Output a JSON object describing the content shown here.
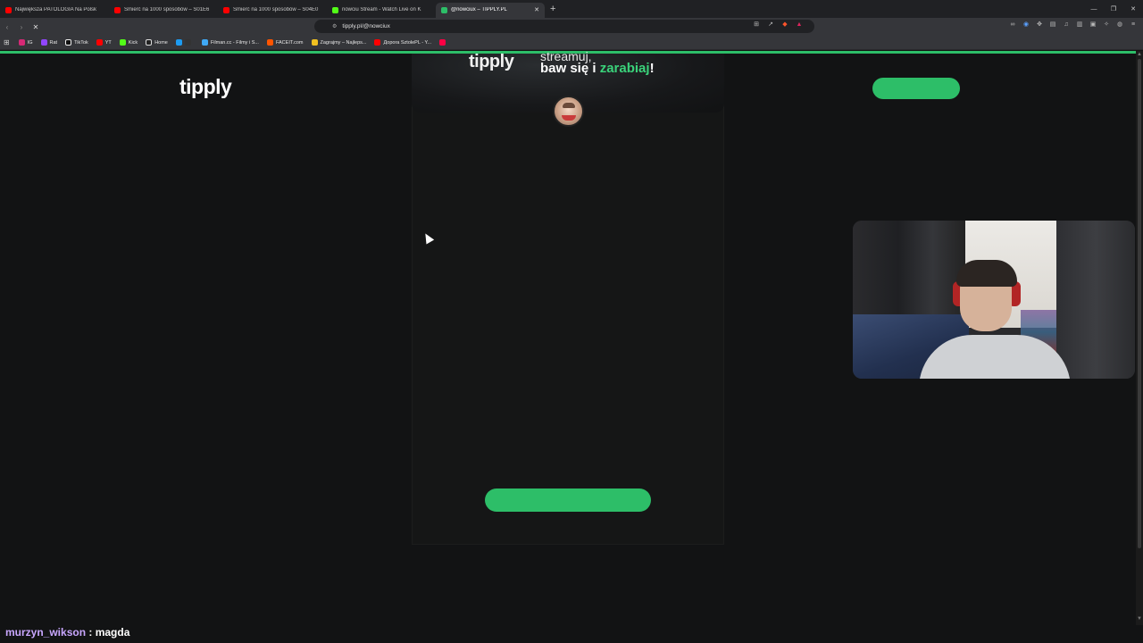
{
  "tabs": [
    {
      "title": "Największa PATOLOGIA Na Polsk",
      "favicon_color": "#ff0000",
      "active": false
    },
    {
      "title": "Śmierć na 1000 sposobów – S01E6",
      "favicon_color": "#ff0000",
      "active": false
    },
    {
      "title": "Śmierć na 1000 sposobów – S04E0",
      "favicon_color": "#ff0000",
      "active": false
    },
    {
      "title": "nowciu Stream - Watch Live on K",
      "favicon_color": "#53fc18",
      "active": false
    },
    {
      "title": "@nowciux – TIPPLY.PL",
      "favicon_color": "#2dbe68",
      "active": true
    }
  ],
  "address": {
    "url": "tipply.pl/@nowciux"
  },
  "bookmarks": [
    {
      "label": "IG",
      "color": "#d62976"
    },
    {
      "label": "Rat",
      "color": "#9146ff"
    },
    {
      "label": "TikTok",
      "color": "#eeeeee"
    },
    {
      "label": "YT",
      "color": "#ff0000"
    },
    {
      "label": "Kick",
      "color": "#53fc18"
    },
    {
      "label": "Home",
      "color": "#dddddd"
    },
    {
      "label": "",
      "color": "#1d9bf0"
    },
    {
      "label": "Filman.cc - Filmy i S...",
      "color": "#3fa9f5"
    },
    {
      "label": "FACEIT.com",
      "color": "#ff5500"
    },
    {
      "label": "Zagrajmy – Najleps...",
      "color": "#f0c020"
    },
    {
      "label": "Доpora SztolePL - Y...",
      "color": "#ff0000"
    },
    {
      "label": "",
      "color": "#ff0044"
    }
  ],
  "page": {
    "logo": "tipply",
    "banner_logo": "tipply",
    "banner_line1": "streamuj,",
    "banner_line2_prefix": "baw się i ",
    "banner_line2_highlight": "zarabiaj",
    "banner_line2_suffix": "!",
    "accent_color": "#2dbe68"
  },
  "chat": {
    "user": "murzyn_wikson",
    "separator": " : ",
    "message": "magda"
  }
}
